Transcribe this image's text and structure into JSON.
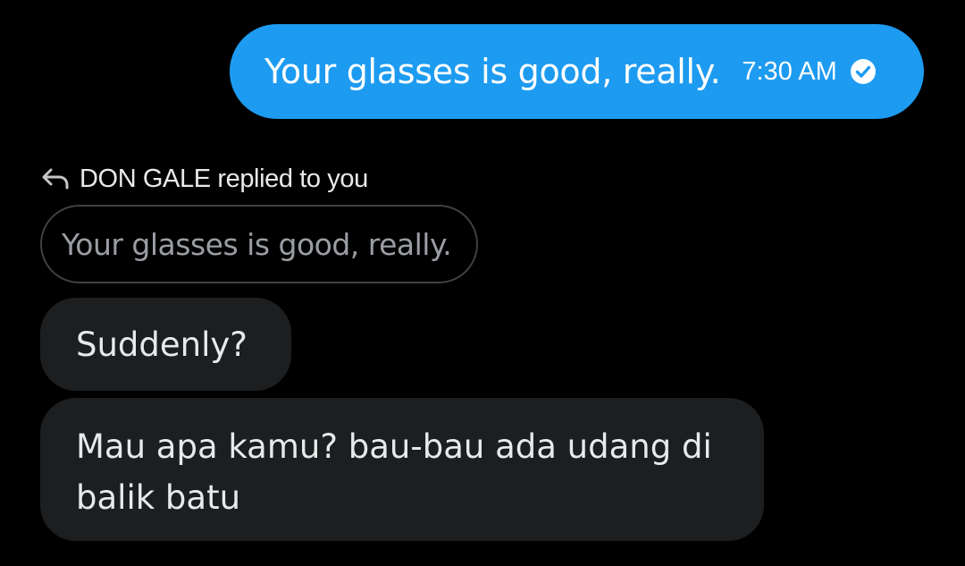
{
  "colors": {
    "background": "#000000",
    "sent_bubble": "#1d9bf0",
    "received_bubble": "#1c1e20",
    "quote_border": "#3e4144",
    "quote_text": "#9a9ea3"
  },
  "sent_message": {
    "text": "Your glasses is good, really.",
    "time": "7:30 AM",
    "status_icon": "seen-check-icon"
  },
  "reply": {
    "icon": "reply-arrow-icon",
    "label": "DON GALE replied to you",
    "quoted_text": "Your glasses is good, really."
  },
  "received_messages": [
    {
      "text": "Suddenly?"
    },
    {
      "text": "Mau apa kamu? bau-bau ada udang di balik batu"
    }
  ]
}
